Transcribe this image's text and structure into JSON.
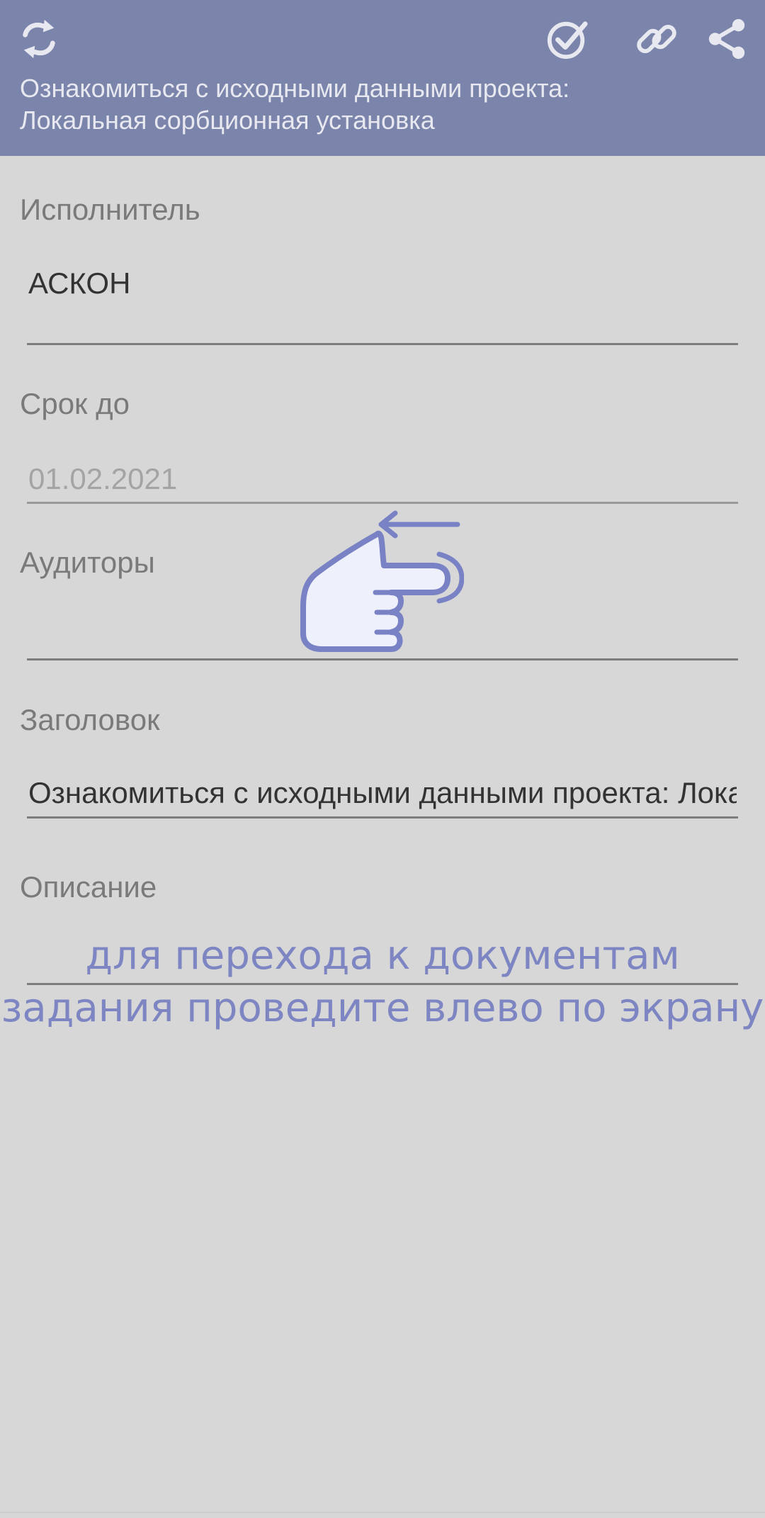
{
  "header": {
    "title_line1": "Ознакомиться с исходными данными проекта:",
    "title_line2": "Локальная сорбционная установка",
    "background_color": "#7b84aa",
    "icons": {
      "refresh": "refresh-icon",
      "approve": "check-circle-icon",
      "link": "link-icon",
      "share": "share-icon"
    }
  },
  "fields": {
    "executor": {
      "label": "Исполнитель",
      "value": "АСКОН"
    },
    "deadline": {
      "label": "Срок до",
      "value": "01.02.2021"
    },
    "auditors": {
      "label": "Аудиторы",
      "value": ""
    },
    "heading": {
      "label": "Заголовок",
      "value": "Ознакомиться с исходными данными проекта: Локальная сорбционная установка"
    },
    "description": {
      "label": "Описание",
      "value": ""
    }
  },
  "hint": {
    "line1": "для перехода к документам",
    "line2": "задания проведите влево по экрану",
    "icon": "swipe-left-hand-icon",
    "color": "#7d86c2"
  }
}
